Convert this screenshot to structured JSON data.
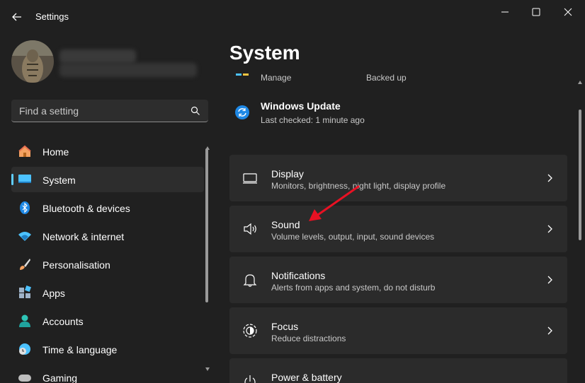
{
  "window": {
    "title": "Settings"
  },
  "search": {
    "placeholder": "Find a setting"
  },
  "sidebar": {
    "items": [
      {
        "label": "Home",
        "icon": "home-icon"
      },
      {
        "label": "System",
        "icon": "system-icon",
        "selected": true
      },
      {
        "label": "Bluetooth & devices",
        "icon": "bluetooth-icon"
      },
      {
        "label": "Network & internet",
        "icon": "wifi-icon"
      },
      {
        "label": "Personalisation",
        "icon": "brush-icon"
      },
      {
        "label": "Apps",
        "icon": "apps-icon"
      },
      {
        "label": "Accounts",
        "icon": "person-icon"
      },
      {
        "label": "Time & language",
        "icon": "clock-globe-icon"
      },
      {
        "label": "Gaming",
        "icon": "gamepad-icon"
      }
    ]
  },
  "main": {
    "title": "System",
    "top_row": {
      "manage_label": "Manage",
      "backed_label": "Backed up"
    },
    "windows_update": {
      "title": "Windows Update",
      "subtitle": "Last checked: 1 minute ago"
    },
    "cards": [
      {
        "title": "Display",
        "subtitle": "Monitors, brightness, night light, display profile",
        "icon": "monitor-icon"
      },
      {
        "title": "Sound",
        "subtitle": "Volume levels, output, input, sound devices",
        "icon": "speaker-icon"
      },
      {
        "title": "Notifications",
        "subtitle": "Alerts from apps and system, do not disturb",
        "icon": "bell-icon"
      },
      {
        "title": "Focus",
        "subtitle": "Reduce distractions",
        "icon": "focus-icon"
      },
      {
        "title": "Power & battery",
        "subtitle": "",
        "icon": "power-icon"
      }
    ]
  },
  "colors": {
    "background": "#202020",
    "card": "#2b2b2b",
    "accent": "#60cdff",
    "annotation_arrow": "#e81123"
  }
}
